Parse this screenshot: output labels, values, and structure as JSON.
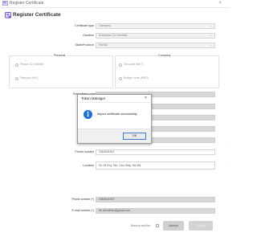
{
  "window": {
    "title": "Register Certificate",
    "close_glyph": "×"
  },
  "header": {
    "title": "Register Certificate"
  },
  "form": {
    "certificate_type": {
      "label": "Certificate type",
      "value": "Company"
    },
    "duration": {
      "label": "Duration",
      "value": "Enterprise (12 months)"
    },
    "state_province": {
      "label": "State/Province",
      "value": "Hà Nội"
    },
    "personal": {
      "label": "Personal",
      "options": [
        "Person ID (CMND)",
        "Passport (HC)"
      ]
    },
    "company": {
      "label": "Company",
      "options": [
        "Tax code (MST)",
        "Budget code (MNS)"
      ]
    },
    "subscriber_company": {
      "label": "Subscriber's compan",
      "value": ""
    },
    "manager": {
      "label": "Manager",
      "value": ""
    },
    "direct_manager": {
      "label": "Direct manag",
      "value": ""
    },
    "tax_code": {
      "label": "Tax cod",
      "value": ""
    },
    "phone_number": {
      "label": "Phone number",
      "value": "0364641847"
    },
    "location": {
      "label": "Location",
      "value": "Số 15 Duy Tân, Cầu Giấy, Hà Nội"
    },
    "phone_contact": {
      "label": "Phone contact (*)",
      "value": "0364641847"
    },
    "email_contact": {
      "label": "E-mail contact (*)",
      "value": "tth.ddt.tdtntn@gmail.com"
    }
  },
  "footer": {
    "backup_label": "Backup key/fier",
    "accept_label": "Accept",
    "cancel_label": "Cancel"
  },
  "dialog": {
    "title": "Token Manager",
    "close_glyph": "×",
    "message": "Import certificate successfully",
    "ok_label": "OK",
    "icon_glyph": "i"
  },
  "colors": {
    "info_blue": "#1e6fd1",
    "brand_purple": "#6b4fbb"
  },
  "icons": {
    "app": "certificate-icon",
    "dialog": "info-icon",
    "dropdown": "chevron-down-icon"
  }
}
